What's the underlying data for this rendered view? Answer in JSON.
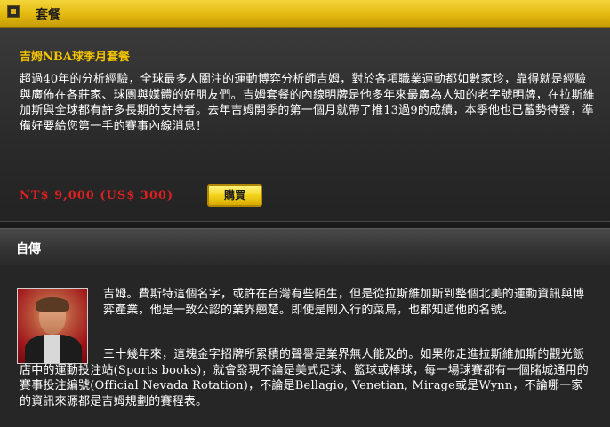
{
  "header": {
    "title": "套餐",
    "icon": "package-icon"
  },
  "package": {
    "title": "吉姆NBA球季月套餐",
    "description": "超過40年的分析經驗，全球最多人關注的運動博弈分析師吉姆，對於各項職業運動都如數家珍，靠得就是經驗與廣佈在各莊家、球團與媒體的好朋友們。吉姆套餐的內線明牌是他多年來最廣為人知的老字號明牌，在拉斯維加斯與全球都有許多長期的支持者。去年吉姆開季的第一個月就帶了推13過9的成績，本季他也已蓄勢待發，準備好要給您第一手的賽事內線消息！",
    "price": "NT$ 9,000 (US$ 300)",
    "buy_label": "購買"
  },
  "bio": {
    "title": "自傳",
    "paragraph1": "吉姆。費斯特這個名字，或許在台灣有些陌生，但是從拉斯維加斯到整個北美的運動資訊與博弈產業，他是一致公認的業界翹楚。即使是剛入行的菜鳥，也都知道他的名號。",
    "paragraph2": "三十幾年來，這塊金字招牌所累積的聲譽是業界無人能及的。如果你走進拉斯維加斯的觀光飯店中的運動投注站(Sports books)，就會發現不論是美式足球、籃球或棒球，每一場球賽都有一個賭城通用的賽事投注編號(Official Nevada Rotation)，不論是Bellagio, Venetian, Mirage或是Wynn，不論哪一家的資訊來源都是吉姆規劃的賽程表。"
  },
  "colors": {
    "accent_gold": "#e3b90f",
    "price_red": "#e02020",
    "title_gold": "#f5c400"
  }
}
